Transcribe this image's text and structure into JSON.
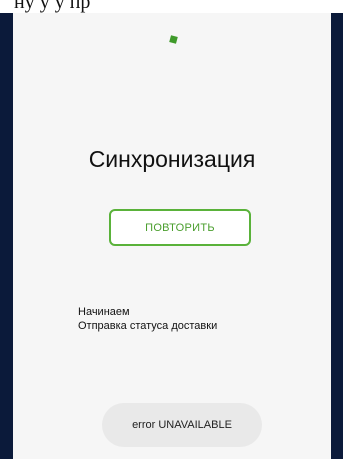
{
  "header": {
    "cropped_text": "ну у у пр"
  },
  "sync": {
    "title": "Синхронизация",
    "retry_label": "ПОВТОРИТЬ",
    "status_lines": [
      "Начинаем",
      "Отправка статуса доставки"
    ]
  },
  "toast": {
    "message": "error UNAVAILABLE"
  },
  "colors": {
    "accent": "#4a9e2d",
    "frame": "#0b1a3a",
    "screen_bg": "#f6f6f6"
  },
  "icons": {
    "progress_indicator": "progress-dot-icon"
  }
}
